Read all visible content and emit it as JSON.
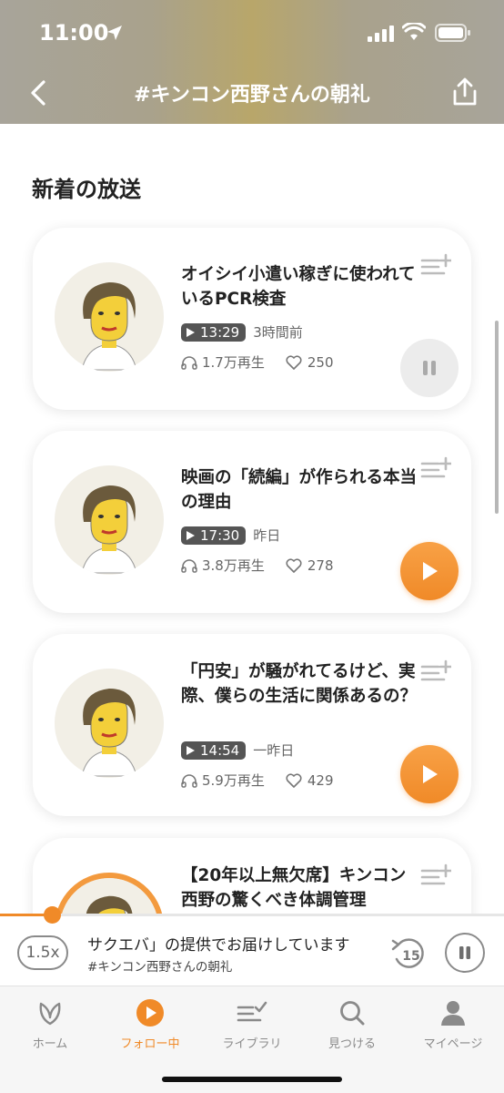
{
  "status_bar": {
    "time": "11:00"
  },
  "header": {
    "title": "#キンコン西野さんの朝礼"
  },
  "section_title": "新着の放送",
  "episodes": [
    {
      "title": "オイシイ小遣い稼ぎに使われているPCR検査",
      "duration": "13:29",
      "posted": "3時間前",
      "plays": "1.7万再生",
      "likes": "250",
      "state": "playing",
      "progress": 0.1
    },
    {
      "title": "映画の「続編」が作られる本当の理由",
      "duration": "17:30",
      "posted": "昨日",
      "plays": "3.8万再生",
      "likes": "278",
      "state": "paused"
    },
    {
      "title": "「円安」が騒がれてるけど、実際、僕らの生活に関係あるの？",
      "duration": "14:54",
      "posted": "一昨日",
      "plays": "5.9万再生",
      "likes": "429",
      "state": "paused"
    },
    {
      "title": "【20年以上無欠席】キンコン西野の驚くべき体調管理"
    }
  ],
  "mini_player": {
    "speed": "1.5x",
    "title": "サクエバ」の提供でお届けしています",
    "subtitle": "#キンコン西野さんの朝礼",
    "skip_seconds": "15"
  },
  "tabs": [
    {
      "label": "ホーム",
      "icon": "leaf-icon",
      "active": false
    },
    {
      "label": "フォロー中",
      "icon": "play-circle-icon",
      "active": true
    },
    {
      "label": "ライブラリ",
      "icon": "library-icon",
      "active": false
    },
    {
      "label": "見つける",
      "icon": "search-icon",
      "active": false
    },
    {
      "label": "マイページ",
      "icon": "person-icon",
      "active": false
    }
  ],
  "colors": {
    "accent": "#f08a28",
    "header_bg": "#a9a28c"
  }
}
